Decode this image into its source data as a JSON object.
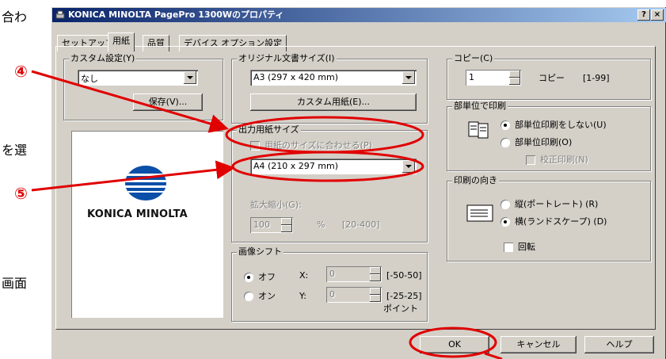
{
  "side_text": {
    "t1": "合わ",
    "t2": "を選",
    "t3": "画面"
  },
  "markers": {
    "m4": "④",
    "m5": "⑤"
  },
  "dialog": {
    "title": "KONICA MINOLTA PagePro 1300Wのプロパティ",
    "help_btn": "?",
    "close_btn": "×",
    "tabs": [
      "セットアップ",
      "用紙",
      "品質",
      "デバイス オプション設定"
    ],
    "active_tab": 1
  },
  "custom": {
    "group_label": "カスタム設定(Y)",
    "combo_value": "なし",
    "save_btn": "保存(V)..."
  },
  "logo_text": "KONICA MINOLTA",
  "original": {
    "group_label": "オリジナル文書サイズ(I)",
    "combo_value": "A3 (297 x 420 mm)",
    "custom_btn": "カスタム用紙(E)..."
  },
  "output": {
    "group_label": "出力用紙サイズ",
    "fit_checkbox": "用紙のサイズに合わせる(P)",
    "combo_value": "A4 (210 x 297 mm)",
    "scale_label": "拡大縮小(G):",
    "scale_value": "100",
    "scale_unit": "%",
    "scale_range": "[20-400]"
  },
  "shift": {
    "group_label": "画像シフト",
    "off": "オフ",
    "on": "オン",
    "x_label": "X:",
    "y_label": "Y:",
    "x_value": "0",
    "y_value": "0",
    "x_range": "[-50-50]",
    "y_range": "[-25-25]",
    "unit": "ポイント"
  },
  "copy": {
    "group_label": "コピー(C)",
    "value": "1",
    "label": "コピー",
    "range": "[1-99]"
  },
  "collate": {
    "group_label": "部単位で印刷",
    "no_collate": "部単位印刷をしない(U)",
    "collate": "部単位印刷(O)",
    "proof": "校正印刷(N)"
  },
  "orientation": {
    "group_label": "印刷の向き",
    "portrait": "縦(ポートレート) (R)",
    "landscape": "横(ランドスケープ) (D)",
    "rotate": "回転"
  },
  "buttons": {
    "ok": "OK",
    "cancel": "キャンセル",
    "help": "ヘルプ"
  },
  "colors": {
    "annotation": "#e00000",
    "title_start": "#0a246a",
    "title_end": "#a6caf0",
    "face": "#d4d0c8",
    "logo_blue": "#0a4fa8"
  }
}
